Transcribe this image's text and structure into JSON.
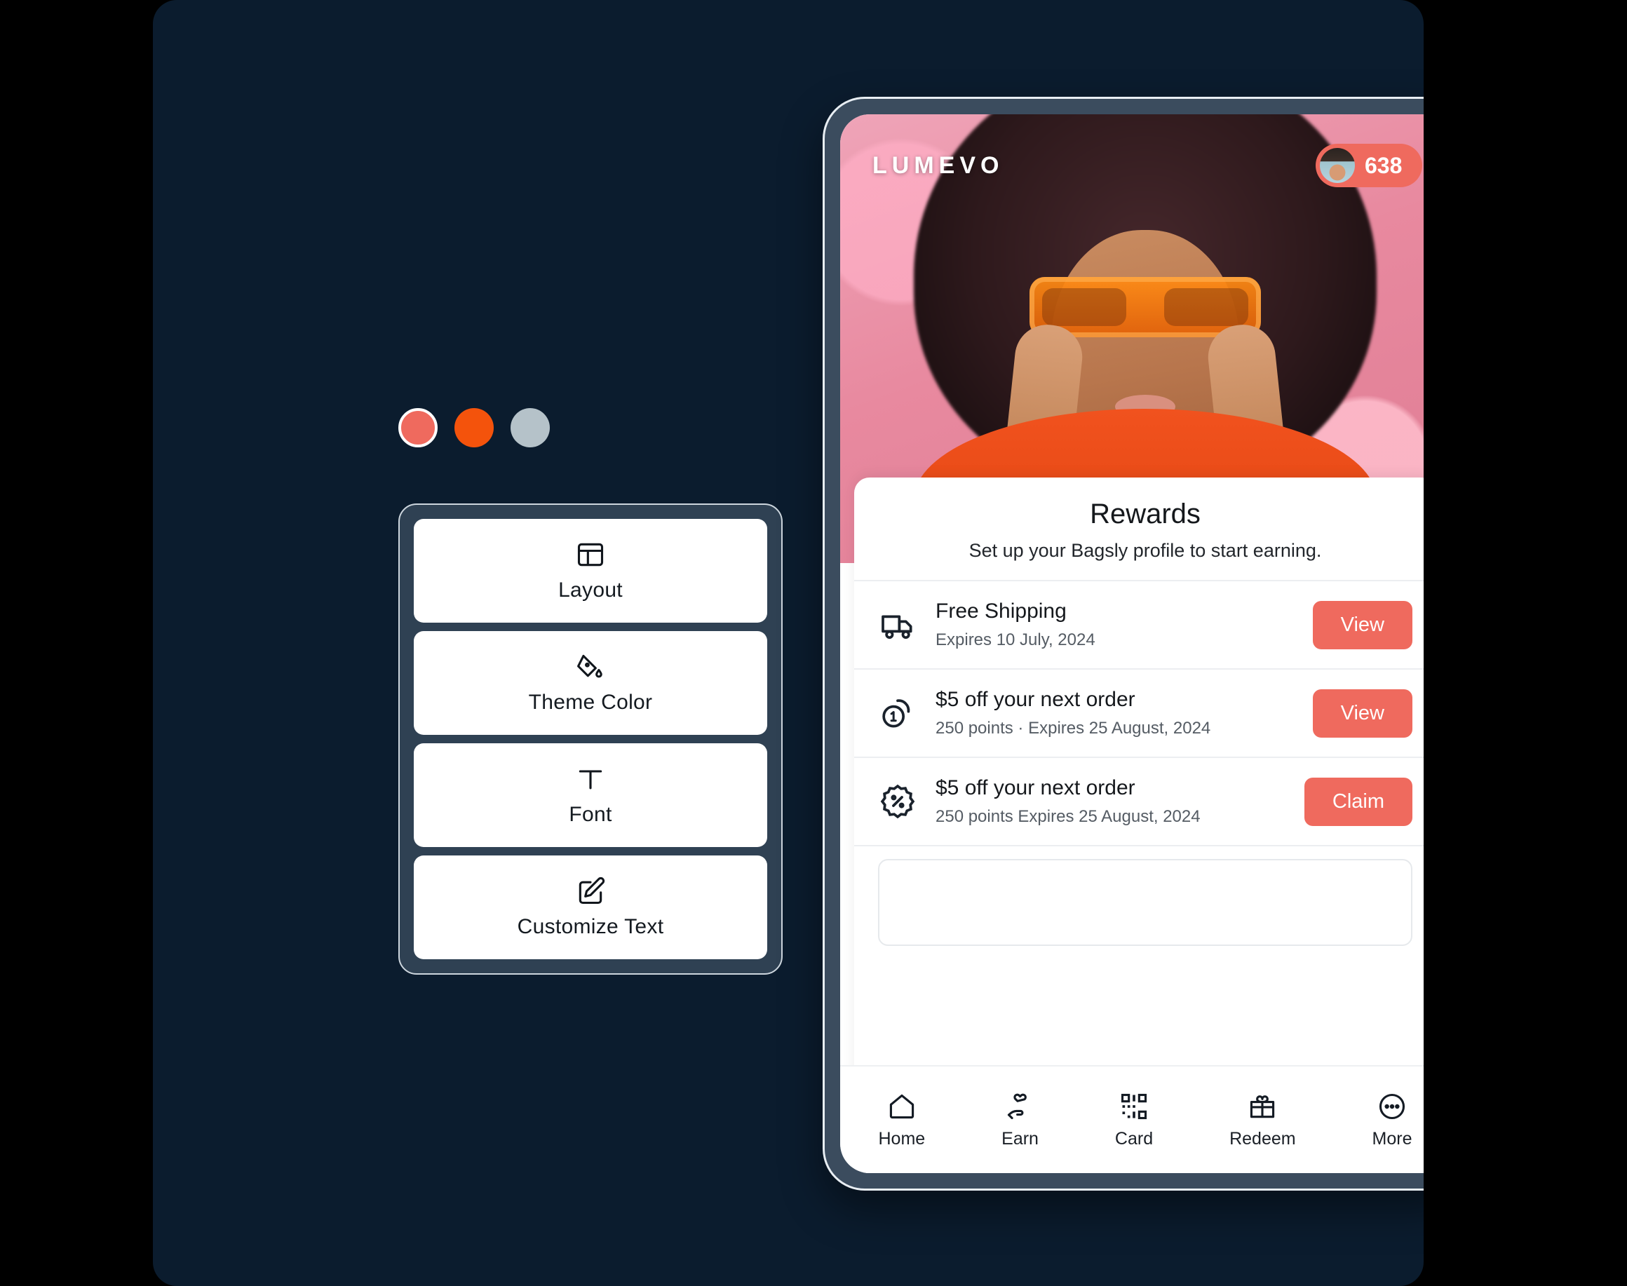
{
  "theme": {
    "canvas_bg": "#0b1c2e",
    "panel_bg": "#2f4153",
    "accent_coral": "#ef6a5e",
    "phone_bezel": "#3b4c5e"
  },
  "editor": {
    "swatches": [
      {
        "name": "coral",
        "hex": "#ef6a5e",
        "selected": true
      },
      {
        "name": "orange",
        "hex": "#f4530c",
        "selected": false
      },
      {
        "name": "slate-gray",
        "hex": "#b5c2c9",
        "selected": false
      }
    ],
    "options": [
      {
        "label": "Layout",
        "icon": "layout-icon"
      },
      {
        "label": "Theme Color",
        "icon": "paint-bucket-icon"
      },
      {
        "label": "Font",
        "icon": "text-format-icon"
      },
      {
        "label": "Customize Text",
        "icon": "edit-square-icon"
      }
    ]
  },
  "phone": {
    "brand": "LUMEVO",
    "points_badge": "638",
    "rewards": {
      "title": "Rewards",
      "subtitle": "Set up your Bagsly profile to start earning.",
      "items": [
        {
          "icon": "truck-icon",
          "name": "Free Shipping",
          "meta": "Expires 10 July, 2024",
          "action": "View"
        },
        {
          "icon": "coins-icon",
          "name": "$5 off your next order",
          "meta": "250 points  · Expires 25 August, 2024",
          "action": "View"
        },
        {
          "icon": "discount-badge-icon",
          "name": "$5 off your next order",
          "meta": "250 points    Expires 25 August, 2024",
          "action": "Claim"
        }
      ]
    },
    "nav": [
      {
        "label": "Home",
        "icon": "home-icon"
      },
      {
        "label": "Earn",
        "icon": "hand-heart-icon"
      },
      {
        "label": "Card",
        "icon": "qr-code-icon"
      },
      {
        "label": "Redeem",
        "icon": "gift-icon"
      },
      {
        "label": "More",
        "icon": "more-circle-icon"
      }
    ]
  }
}
